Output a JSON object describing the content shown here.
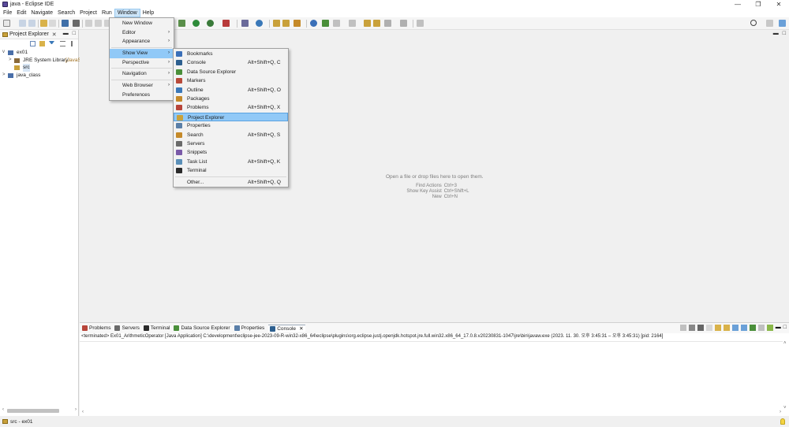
{
  "window": {
    "title": "java - Eclipse IDE",
    "controls": [
      "—",
      "❐",
      "✕"
    ]
  },
  "menubar": [
    "File",
    "Edit",
    "Navigate",
    "Search",
    "Project",
    "Run",
    "Window",
    "Help"
  ],
  "project_explorer": {
    "tab_label": "Project Explorer",
    "tree": [
      {
        "label": "ex01",
        "arrow": "v"
      },
      {
        "label": "JRE System Library",
        "suffix": "[JavaS",
        "arrow": ">"
      },
      {
        "label": "src",
        "arrow": ""
      },
      {
        "label": "java_class",
        "arrow": ">"
      }
    ]
  },
  "window_menu": {
    "items": [
      {
        "label": "New Window",
        "submenu": false
      },
      {
        "label": "Editor",
        "submenu": true
      },
      {
        "label": "Appearance",
        "submenu": true
      },
      {
        "label": "Show View",
        "submenu": true,
        "highlighted": true
      },
      {
        "label": "Perspective",
        "submenu": true
      },
      {
        "label": "Navigation",
        "submenu": true
      },
      {
        "label": "Web Browser",
        "submenu": true
      },
      {
        "label": "Preferences",
        "submenu": false
      }
    ]
  },
  "show_view_menu": {
    "items": [
      {
        "label": "Bookmarks",
        "shortcut": "",
        "color": "#3a6fb8"
      },
      {
        "label": "Console",
        "shortcut": "Alt+Shift+Q, C",
        "color": "#2d5f8f"
      },
      {
        "label": "Data Source Explorer",
        "shortcut": "",
        "color": "#4a8f3a"
      },
      {
        "label": "Markers",
        "shortcut": "",
        "color": "#b84a3a"
      },
      {
        "label": "Outline",
        "shortcut": "Alt+Shift+Q, O",
        "color": "#3a78b8"
      },
      {
        "label": "Packages",
        "shortcut": "",
        "color": "#c58a2a"
      },
      {
        "label": "Problems",
        "shortcut": "Alt+Shift+Q, X",
        "color": "#b8453a"
      },
      {
        "label": "Project Explorer",
        "shortcut": "",
        "color": "#c9a13b",
        "highlighted": true
      },
      {
        "label": "Properties",
        "shortcut": "",
        "color": "#5a7fa8"
      },
      {
        "label": "Search",
        "shortcut": "Alt+Shift+Q, S",
        "color": "#c58a2a"
      },
      {
        "label": "Servers",
        "shortcut": "",
        "color": "#6a6a6a"
      },
      {
        "label": "Snippets",
        "shortcut": "",
        "color": "#7a5aa8"
      },
      {
        "label": "Task List",
        "shortcut": "Alt+Shift+Q, K",
        "color": "#5a8fb8"
      },
      {
        "label": "Terminal",
        "shortcut": "",
        "color": "#2a2a2a"
      },
      {
        "label": "Other...",
        "shortcut": "Alt+Shift+Q, Q",
        "color": ""
      }
    ]
  },
  "editor": {
    "hint": "Open a file or drop files here to open them.",
    "shortcuts": [
      {
        "name": "Find Actions",
        "keys": "Ctrl+3"
      },
      {
        "name": "Show Key Assist",
        "keys": "Ctrl+Shift+L"
      },
      {
        "name": "New",
        "keys": "Ctrl+N"
      }
    ]
  },
  "bottom_panel": {
    "tabs": [
      {
        "label": "Problems",
        "color": "#b8453a"
      },
      {
        "label": "Servers",
        "color": "#6a6a6a"
      },
      {
        "label": "Terminal",
        "color": "#2a2a2a"
      },
      {
        "label": "Data Source Explorer",
        "color": "#4a8f3a"
      },
      {
        "label": "Properties",
        "color": "#5a7fa8"
      },
      {
        "label": "Console",
        "color": "#2d5f8f",
        "active": true
      }
    ],
    "console_status": "<terminated> Ex01_ArithmeticOperator [Java Application] C:\\development\\eclipse-jee-2023-09-R-win32-x86_64\\eclipse\\plugins\\org.eclipse.justj.openjdk.hotspot.jre.full.win32.x86_64_17.0.8.v20230831-1047\\jre\\bin\\javaw.exe  (2023. 11. 30. 오후 3:45:31 – 오후 3:45:31) [pid: 2164]"
  },
  "statusbar": {
    "text": "src - ex01"
  }
}
